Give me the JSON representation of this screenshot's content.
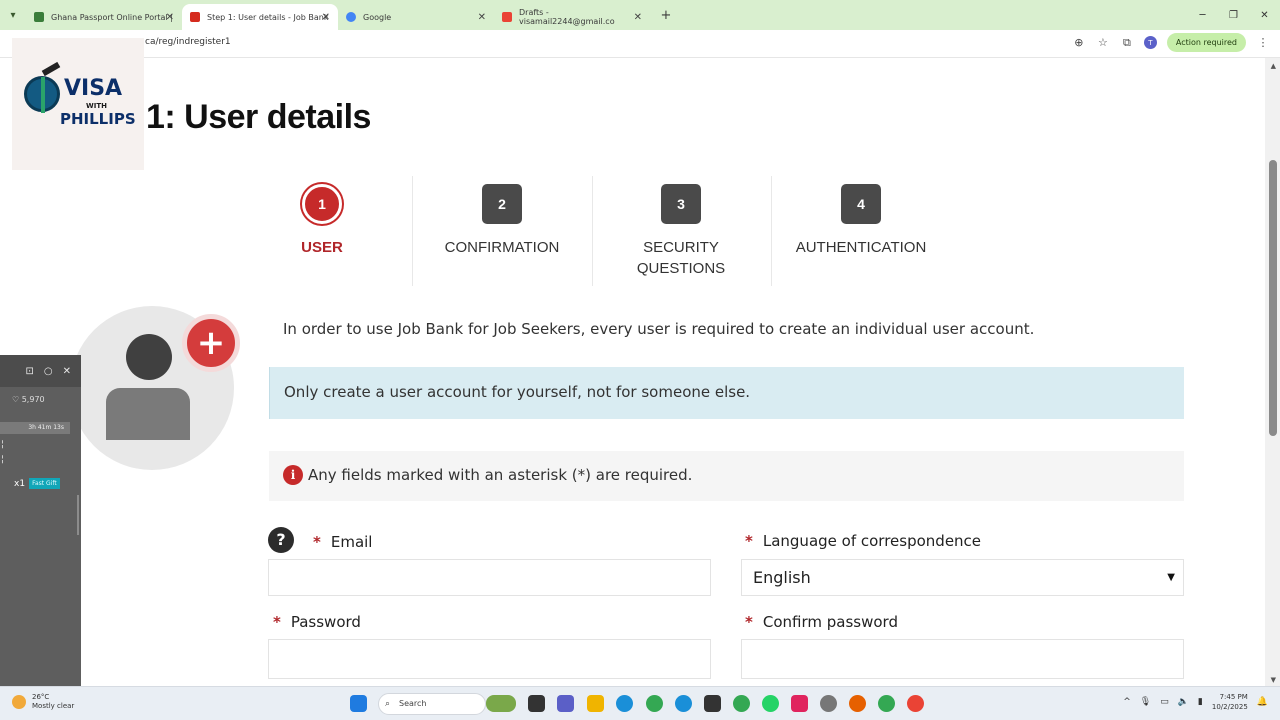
{
  "browser": {
    "tabs": [
      {
        "title": "Ghana Passport Online Portal |",
        "favicon_color": "#3a7d3a",
        "active": false
      },
      {
        "title": "Step 1: User details - Job Bank",
        "favicon_color": "#d52b1e",
        "active": true
      },
      {
        "title": "Google",
        "favicon_color": "#4285f4",
        "active": false
      },
      {
        "title": "Drafts - visamail2244@gmail.co",
        "favicon_color": "#ea4335",
        "active": false
      }
    ],
    "new_tab": "+",
    "url": "ca/reg/indregister1",
    "profile_initial": "T",
    "action_required": "Action required"
  },
  "logo": {
    "line1": "VISA",
    "line2": "WITH",
    "line3": "PHILLIPS"
  },
  "page": {
    "title": "1: User details",
    "steps": [
      {
        "num": "1",
        "label": "USER"
      },
      {
        "num": "2",
        "label": "CONFIRMATION"
      },
      {
        "num": "3",
        "label": "SECURITY\nQUESTIONS"
      },
      {
        "num": "4",
        "label": "AUTHENTICATION"
      }
    ],
    "intro": "In order to use Job Bank for Job Seekers, every user is required to create an individual user account.",
    "info_notice": "Only create a user account for yourself, not for someone else.",
    "required_notice": "Any fields marked with an asterisk (*) are required.",
    "fields": {
      "email_label": "Email",
      "language_label": "Language of correspondence",
      "language_value": "English",
      "password_label": "Password",
      "confirm_password_label": "Confirm password",
      "asterisk": "*"
    }
  },
  "widget": {
    "likes": "♡ 5,970",
    "timer": "3h 41m 13s",
    "speed": "x1",
    "speed_tag": "Fast Gift"
  },
  "taskbar": {
    "temperature": "26°C",
    "weather": "Mostly clear",
    "search_placeholder": "Search",
    "time": "7:45 PM",
    "date": "10/2/2025"
  },
  "colors": {
    "accent_red": "#b0262a",
    "info_bg": "#d9ecf2",
    "tabbar_bg": "#d9efcf"
  }
}
